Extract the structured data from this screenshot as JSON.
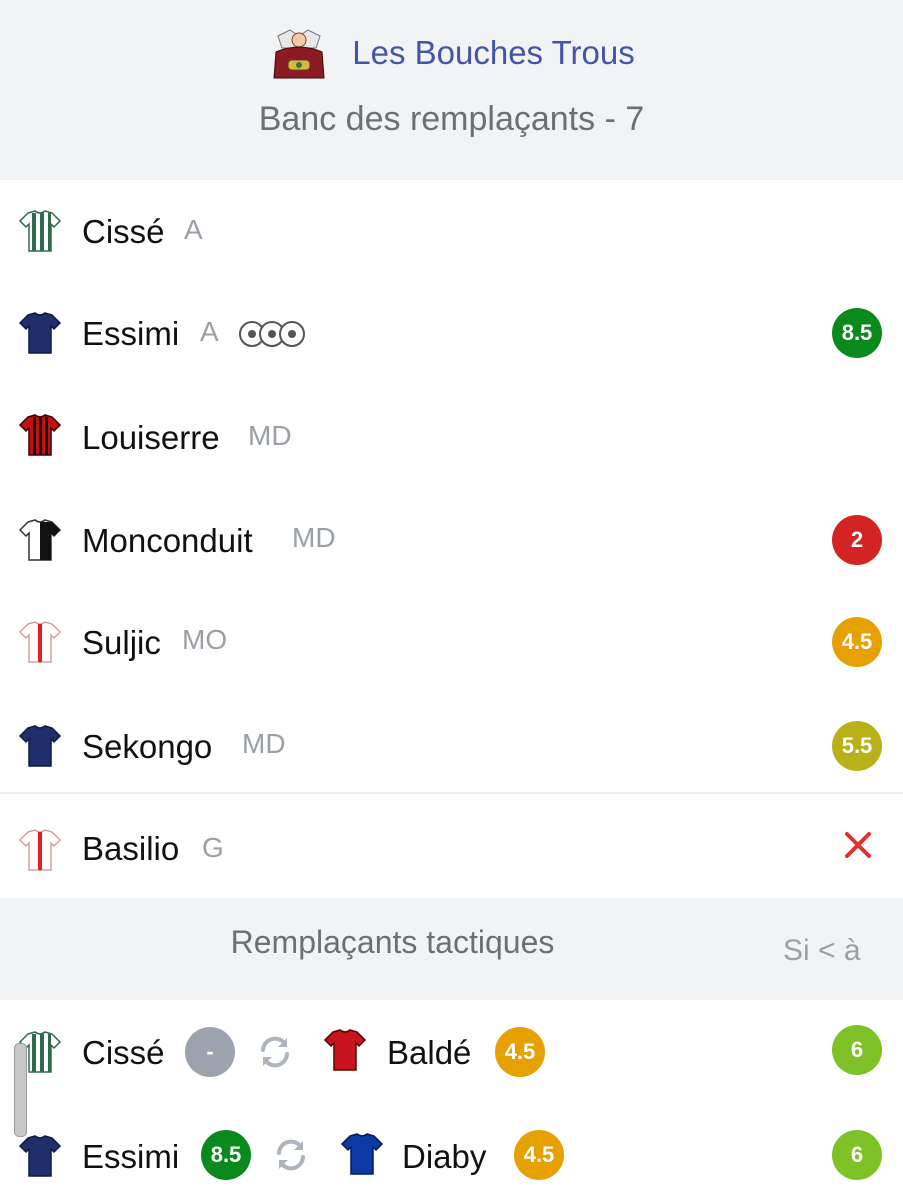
{
  "header": {
    "team_name": "Les Bouches Trous",
    "bench_title": "Banc des remplaçants - 7"
  },
  "bench": [
    {
      "name": "Cissé",
      "position": "A",
      "jersey": "green-white-stripes",
      "goals": 0,
      "rating": null,
      "status": "none"
    },
    {
      "name": "Essimi",
      "position": "A",
      "jersey": "navy-blue",
      "goals": 3,
      "rating": "8.5",
      "rating_color": "#0a8a1c"
    },
    {
      "name": "Louiserre",
      "position": "MD",
      "jersey": "red-black-stripes",
      "rating": null
    },
    {
      "name": "Monconduit",
      "position": "MD",
      "jersey": "black-white",
      "rating": "2",
      "rating_color": "#d42323"
    },
    {
      "name": "Suljic",
      "position": "MO",
      "jersey": "white-red",
      "rating": "4.5",
      "rating_color": "#e6a100"
    },
    {
      "name": "Sekongo",
      "position": "MD",
      "jersey": "navy-blue",
      "rating": "5.5",
      "rating_color": "#b9b01a"
    },
    {
      "name": "Basilio",
      "position": "G",
      "jersey": "white-red",
      "rating": null,
      "status": "absent-cross"
    }
  ],
  "tactical": {
    "title": "Remplaçants tactiques",
    "condition": "Si < à",
    "subs": [
      {
        "out_name": "Cissé",
        "out_rating": "-",
        "out_rating_color": "#9ca3af",
        "out_jersey": "green-white-stripes",
        "in_name": "Baldé",
        "in_rating": "4.5",
        "in_rating_color": "#e6a100",
        "in_jersey": "red",
        "threshold": "6",
        "threshold_color": "#7ec227"
      },
      {
        "out_name": "Essimi",
        "out_rating": "8.5",
        "out_rating_color": "#0a8a1c",
        "out_jersey": "navy-blue",
        "in_name": "Diaby",
        "in_rating": "4.5",
        "in_rating_color": "#e6a100",
        "in_jersey": "blue",
        "threshold": "6",
        "threshold_color": "#7ec227"
      }
    ]
  },
  "icons": {
    "swap": "swap-arrows-icon",
    "absent": "red-cross-icon",
    "goals": "football-icon"
  }
}
